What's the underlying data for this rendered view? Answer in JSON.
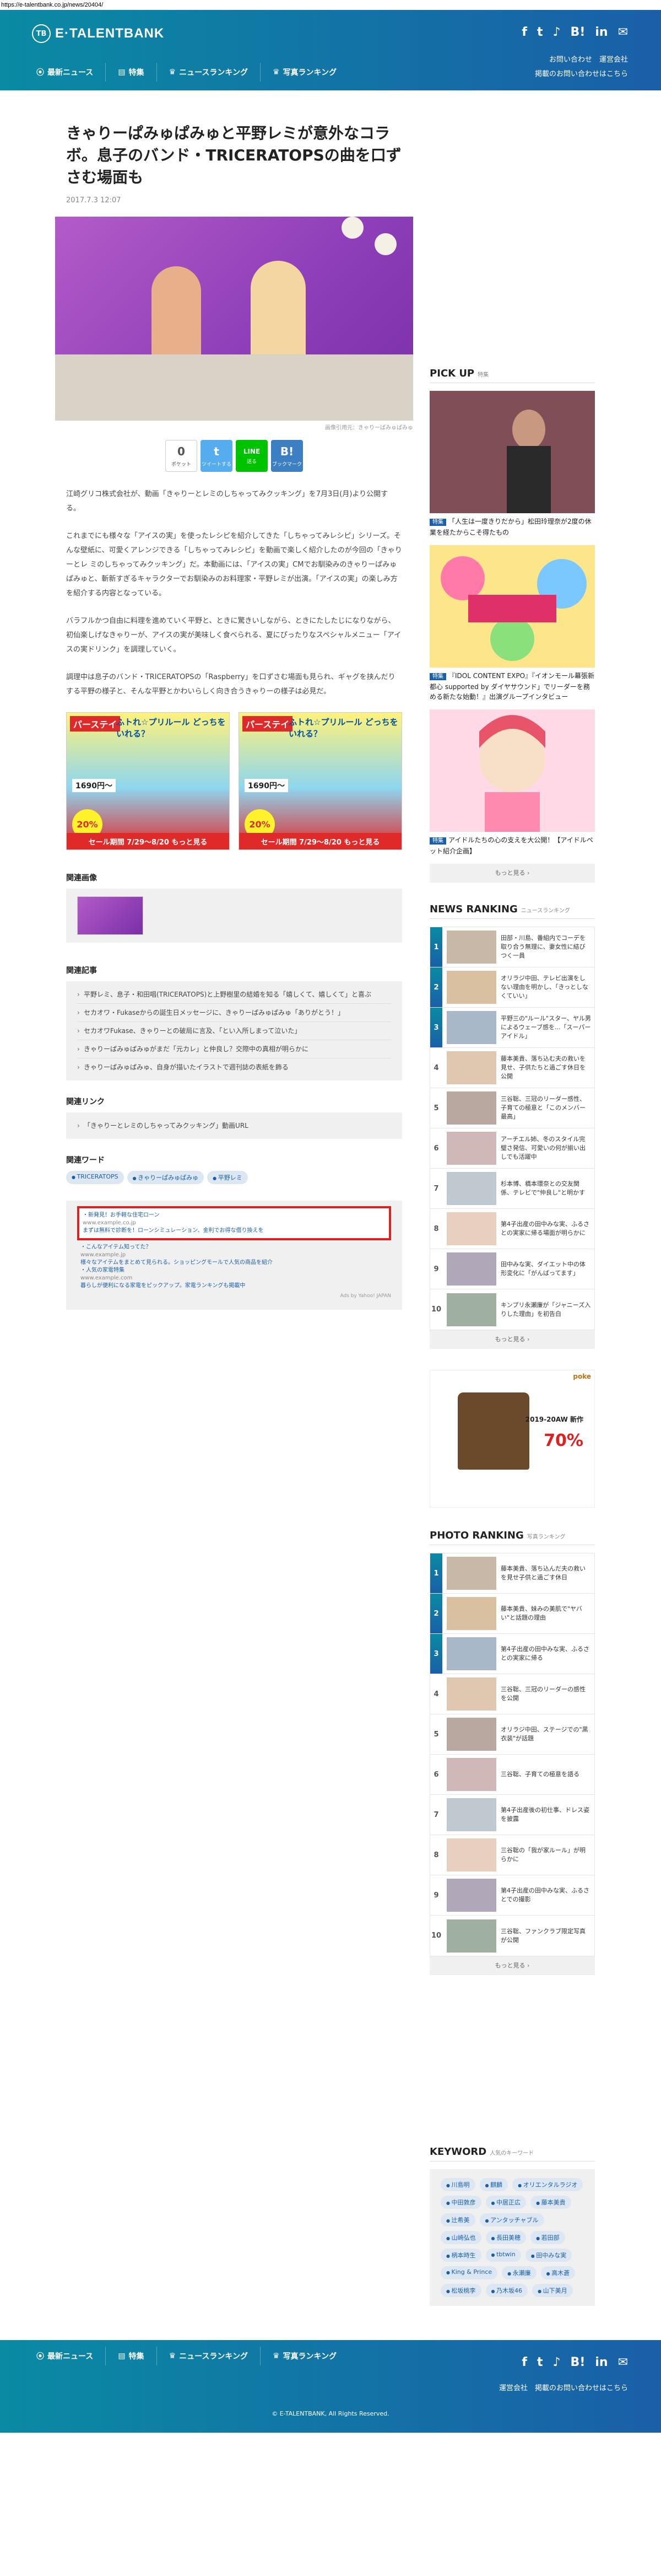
{
  "url": "https://e-talentbank.co.jp/news/20404/",
  "site": {
    "logo_mark": "TB",
    "logo_text": "E·TALENTBANK"
  },
  "social": [
    "f",
    "t",
    "♪",
    "B!",
    "in",
    "✉"
  ],
  "header_links": [
    "お問い合わせ",
    "運営会社",
    "掲載のお問い合わせはこちら"
  ],
  "nav": [
    {
      "icon": "⦿",
      "label": "最新ニュース"
    },
    {
      "icon": "▤",
      "label": "特集"
    },
    {
      "icon": "♛",
      "label": "ニュースランキング"
    },
    {
      "icon": "♛",
      "label": "写真ランキング"
    }
  ],
  "article": {
    "title": "きゃりーぱみゅぱみゅと平野レミが意外なコラボ。息子のバンド・TRICERATOPSの曲を口ずさむ場面も",
    "date": "2017.7.3 12:07",
    "caption": "画像引用元：きゃりーぱみゅぱみゅ",
    "share": [
      {
        "icon": "0",
        "label": "ポケット"
      },
      {
        "icon": "t",
        "label": "ツイートする"
      },
      {
        "icon": "LINE",
        "label": "送る"
      },
      {
        "icon": "B!",
        "label": "ブックマーク"
      }
    ],
    "paragraphs": [
      "江崎グリコ株式会社が、動画「きゃりーとレミのしちゃってみクッキング」を7月3日(月)より公開する。",
      "これまでにも様々な「アイスの実」を使ったレシピを紹介してきた「しちゃってみレシピ」シリーズ。そんな壁紙に、可愛くアレンジできる「しちゃってみレシピ」を動画で楽しく紹介したのが今回の「きゃりーとレ ミのしちゃってみクッキング」だ。本動画には、「アイスの実」CMでお馴染みのきゃりーぱみゅぱみゅと、斬新すぎるキャラクターでお馴染みのお料理家・平野レミが出演。「アイスの実」の楽しみ方を紹介する内容となっている。",
      "バラフルかつ自由に料理を進めていく平野と、ときに驚きいしながら、ときにたしたじになりながら、初仙楽しげなきゃりーが、アイスの実が美味しく食べられる、夏にぴったりなスペシャルメニュー「アイスの実ドリンク」を調理していく。",
      "調理中は息子のバンド・TRICERATOPSの「Raspberry」を口ずさむ場面も見られ、ギャグを挟んだりする平野の様子と、そんな平野とかわいらしく向き合うきゃりーの様子は必見だ。"
    ],
    "ad": {
      "t1": "パーステイ",
      "t2": "ふトれ☆プリルール どっちをいれる？",
      "price": "1690円〜",
      "badge": "20%",
      "bar": "セール期間 7/29〜8/20 もっと見る"
    },
    "gallery_title": "関連画像",
    "related_title": "関連記事",
    "related": [
      "平野レミ、息子・和田唱(TRICERATOPS)と上野樹里の結婚を知る「嬉しくて、嬉しくて」と喜ぶ",
      "セカオワ・Fukaseからの誕生日メッセージに、きゃりーぱみゅぱみゅ「ありがとう！」",
      "セカオワFukase、きゃりーとの破局に言及、「とい入所しまって泣いた」",
      "きゃりーぱみゅぱみゅがまだ「元カレ」と仲良し？交際中の真相が明らかに",
      "きゃりーぱみゅぱみゅ、自身が描いたイラストで週刊誌の表紙を飾る"
    ],
    "links_title": "関連リンク",
    "links": [
      "「きゃりーとレミのしちゃってみクッキング」動画URL"
    ],
    "keywords_title": "関連ワード",
    "keywords": [
      "TRICERATOPS",
      "きゃりーぱみゅぱみゅ",
      "平野レミ"
    ],
    "recommend": [
      "・新発見！お手軽な住宅ローン",
      "www.example.co.jp",
      "まずは無料で診断を！ローンシミュレーション、金利でお得な借り換えを",
      "・こんなアイテム知ってた？",
      "www.example.jp",
      "様々なアイテムをまとめて見られる。ショッピングモールで人気の商品を紹介",
      "・人気の家電特集",
      "www.example.com",
      "暮らしが便利になる家電をピックアップ。家電ランキングも掲載中"
    ],
    "yahoo": "Ads by Yahoo! JAPAN"
  },
  "side": {
    "pickup_title": "PICK UP",
    "pickup_sub": "特集",
    "picks": [
      {
        "badge": "特集",
        "text": "「人生は一度きりだから」松田玲理奈が2度の休業を経たからこそ得たもの"
      },
      {
        "badge": "特集",
        "text": "『IDOL CONTENT EXPO』『イオンモール幕張新都心 supported by ダイヤサウンド」でリーダーを務める新たな始動！』出演グループインタビュー"
      },
      {
        "badge": "特集",
        "text": "アイドルたちの心の支えを大公開！【アイドルペット紹介企画】"
      }
    ],
    "more": "もっと見る ›",
    "news_title": "NEWS RANKING",
    "news_sub": "ニュースランキング",
    "news": [
      "田部・川島、番組内でコーデを取り合う無理に、妻女性に結びつく一員",
      "オリラジ中田、テレビ出演をしない理由を明かし、「きっとしなくていい」",
      "平野三の\"ルール\"スター、ヤル男によるウェーブ感を...「スーパーアイドル」",
      "藤本美貴、落ち込む夫の救いを見せ、子供たちと過ごす休日を公開",
      "三谷聡、三冠のリーダー感性、子育ての極意と「このメンバー最高」",
      "アーチエル姉、冬のスタイル完璧さ発信、可愛いの何が揃い出しでも活躍中",
      "杉本博、橋本環奈との交友関係、テレビで\"仲良し\"と明かす",
      "第4子出産の田中みな実、ふるさとの実家に帰る場面が明らかに",
      "田中みな実、ダイエット中の体形変化に「がんばってます」",
      "キンプリ永瀬廉が「ジャニーズ入りした理由」を初告白"
    ],
    "ad_logo": "poke",
    "ad_text": "2019-20AW 新作",
    "ad_pct": "70%",
    "photo_title": "PHOTO RANKING",
    "photo_sub": "写真ランキング",
    "photos": [
      "藤本美貴、落ち込んだ夫の救いを見せ子供と過ごす休日",
      "藤本美貴、妹みの美肌で\"ヤバい\"と話題の理由",
      "第4子出産の田中みな実、ふるさとの実家に帰る",
      "三谷聡、三冠のリーダーの感性を公開",
      "オリラジ中田、ステージでの\"黒衣装\"が話題",
      "三谷聡、子育ての極意を語る",
      "第4子出産後の初仕事、ドレス姿を披露",
      "三谷聡の「我が家ルール」が明らかに",
      "第4子出産の田中みな実、ふるさとでの撮影",
      "三谷聡、ファンクラブ限定写真が公開"
    ],
    "kw_title": "KEYWORD",
    "kw_sub": "人気のキーワード",
    "kws": [
      "川島明",
      "麒麟",
      "オリエンタルラジオ",
      "中田敦彦",
      "中居正広",
      "藤本美貴",
      "辻希美",
      "アンタッチャブル",
      "山崎弘也",
      "長田美穂",
      "若田部",
      "柄本時生",
      "tbtwin",
      "田中みな実",
      "King & Prince",
      "永瀬廉",
      "高木蒼",
      "松坂桃李",
      "乃木坂46",
      "山下美月"
    ]
  },
  "footer": {
    "links": [
      "運営会社",
      "掲載のお問い合わせはこちら"
    ],
    "copy": "© E-TALENTBANK, All Rights Reserved."
  }
}
